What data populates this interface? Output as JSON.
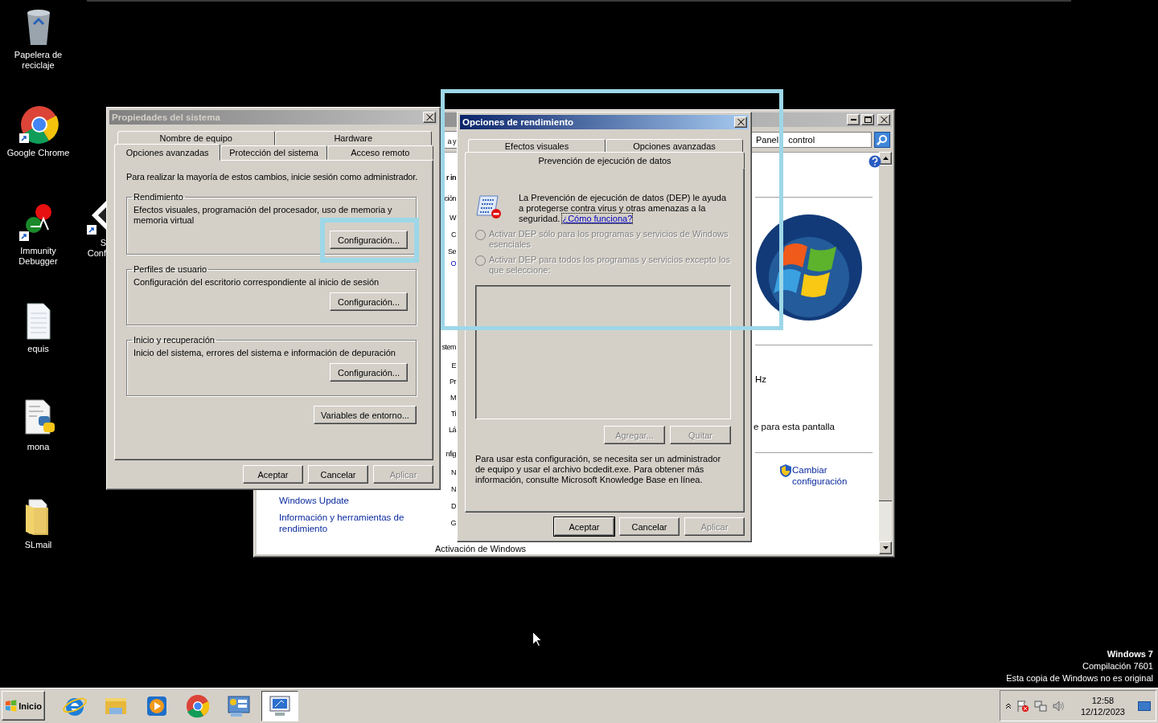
{
  "desktop_icons": [
    {
      "label": "Papelera de reciclaje",
      "kind": "recycle"
    },
    {
      "label": "Google Chrome",
      "kind": "chrome"
    },
    {
      "label": "Immunity Debugger",
      "kind": "debugger"
    },
    {
      "label": "equis",
      "kind": "document"
    },
    {
      "label": "mona",
      "kind": "python"
    },
    {
      "label": "SLmail",
      "kind": "folder"
    }
  ],
  "partial_icon": {
    "lines": [
      "S",
      "Conf"
    ]
  },
  "control_panel": {
    "active": false,
    "search": {
      "words": [
        "Panel",
        "control"
      ]
    },
    "fragments": [
      {
        "text": "a y",
        "kind": "text"
      },
      {
        "text": "r in",
        "kind": "heading"
      },
      {
        "text": "ción",
        "kind": "text"
      },
      {
        "text": "W",
        "kind": "text"
      },
      {
        "text": "C",
        "kind": "text"
      },
      {
        "text": "Se",
        "kind": "text"
      },
      {
        "text": "O",
        "kind": "link"
      },
      {
        "text": "stem",
        "kind": "text"
      },
      {
        "text": "E",
        "kind": "text"
      },
      {
        "text": "Pr",
        "kind": "text"
      },
      {
        "text": "M",
        "kind": "text"
      },
      {
        "text": "Ti",
        "kind": "text"
      },
      {
        "text": "Lá",
        "kind": "text"
      },
      {
        "text": "nfig",
        "kind": "text"
      },
      {
        "text": "N",
        "kind": "text"
      },
      {
        "text": "N",
        "kind": "text"
      },
      {
        "text": "D",
        "kind": "text"
      },
      {
        "text": "G",
        "kind": "text"
      },
      {
        "text": "Activación de Windows",
        "kind": "text"
      }
    ],
    "links": [
      "Windows Update",
      "Información y herramientas de rendimiento"
    ],
    "right_texts": [
      "Hz",
      "e para esta pantalla"
    ],
    "change_link": "Cambiar configuración"
  },
  "system_properties": {
    "title": "Propiedades del sistema",
    "active": false,
    "tab_rows": [
      [
        {
          "label": "Nombre de equipo",
          "selected": false
        },
        {
          "label": "Hardware",
          "selected": false
        }
      ],
      [
        {
          "label": "Opciones avanzadas",
          "selected": true
        },
        {
          "label": "Protección del sistema",
          "selected": false
        },
        {
          "label": "Acceso remoto",
          "selected": false
        }
      ]
    ],
    "intro": "Para realizar la mayoría de estos cambios, inicie sesión como administrador.",
    "groups": [
      {
        "title": "Rendimiento",
        "description": "Efectos visuales, programación del procesador, uso de memoria y memoria virtual",
        "button": "Configuración..."
      },
      {
        "title": "Perfiles de usuario",
        "description": "Configuración del escritorio correspondiente al inicio de sesión",
        "button": "Configuración..."
      },
      {
        "title": "Inicio y recuperación",
        "description": "Inicio del sistema, errores del sistema e información de depuración",
        "button": "Configuración..."
      }
    ],
    "env_button": "Variables de entorno...",
    "buttons": [
      {
        "label": "Aceptar",
        "disabled": false,
        "default": false
      },
      {
        "label": "Cancelar",
        "disabled": false,
        "default": false
      },
      {
        "label": "Aplicar",
        "disabled": true,
        "default": false
      }
    ]
  },
  "performance_options": {
    "title": "Opciones de rendimiento",
    "active": true,
    "tab_rows": [
      [
        {
          "label": "Efectos visuales",
          "selected": false
        },
        {
          "label": "Opciones avanzadas",
          "selected": false
        }
      ],
      [
        {
          "label": "Prevención de ejecución de datos",
          "selected": true
        }
      ]
    ],
    "description": "La Prevención de ejecución de datos (DEP) le ayuda a protegerse contra virus y otras amenazas a la seguridad.",
    "link": "¿Cómo funciona?",
    "radios": [
      {
        "label": "Activar DEP sólo para los programas y servicios de Windows esenciales",
        "selected": false,
        "disabled": true
      },
      {
        "label": "Activar DEP para todos los programas y servicios excepto los que seleccione:",
        "selected": false,
        "disabled": true
      }
    ],
    "list_buttons": [
      {
        "label": "Agregar...",
        "disabled": true
      },
      {
        "label": "Quitar",
        "disabled": true
      }
    ],
    "note": "Para usar esta configuración, se necesita ser un administrador de equipo y usar el archivo bcdedit.exe. Para obtener más información, consulte Microsoft Knowledge Base en línea.",
    "buttons": [
      {
        "label": "Aceptar",
        "disabled": false,
        "default": true
      },
      {
        "label": "Cancelar",
        "disabled": false,
        "default": false
      },
      {
        "label": "Aplicar",
        "disabled": true,
        "default": false
      }
    ]
  },
  "os_notice": [
    "Windows 7",
    "Compilación 7601",
    "Esta copia de Windows no es original"
  ],
  "taskbar": {
    "start_label": "Inicio",
    "apps": [
      {
        "kind": "ie",
        "selected": false
      },
      {
        "kind": "explorer",
        "selected": false
      },
      {
        "kind": "media",
        "selected": false
      },
      {
        "kind": "chrome",
        "selected": false
      },
      {
        "kind": "control",
        "selected": false
      },
      {
        "kind": "system",
        "selected": true
      }
    ],
    "clock": {
      "time": "12:58",
      "date": "12/12/2023"
    }
  }
}
